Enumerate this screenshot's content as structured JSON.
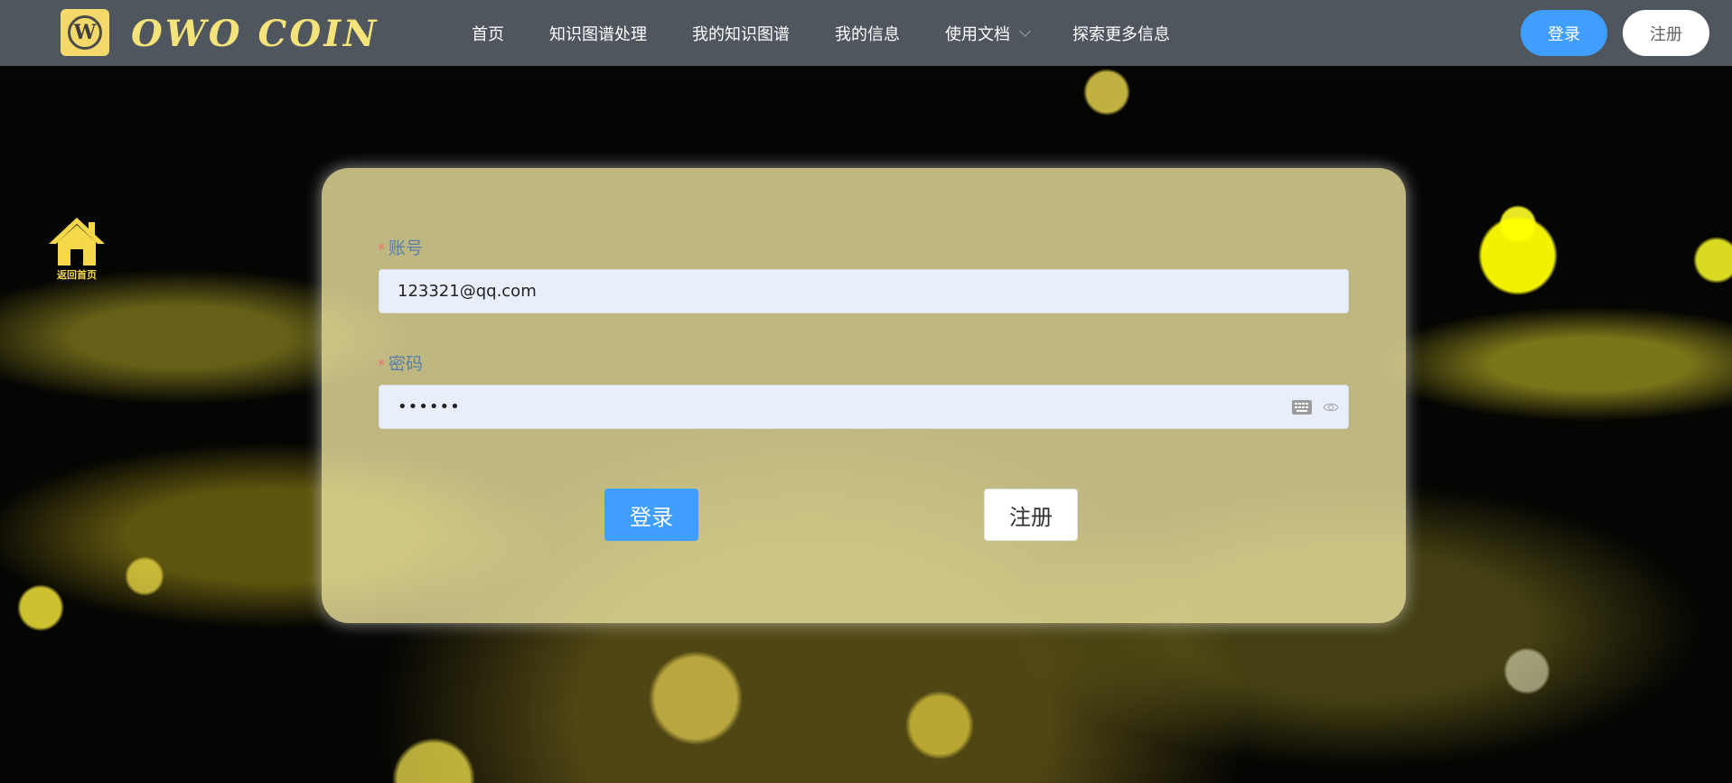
{
  "brand": {
    "logo_letter": "W",
    "name": "OWO COIN",
    "logo_color": "#f3d96a"
  },
  "nav": {
    "items": [
      {
        "label": "首页"
      },
      {
        "label": "知识图谱处理"
      },
      {
        "label": "我的知识图谱"
      },
      {
        "label": "我的信息"
      },
      {
        "label": "使用文档",
        "has_dropdown": true
      },
      {
        "label": "探索更多信息"
      }
    ],
    "login_label": "登录",
    "register_label": "注册"
  },
  "back_home": {
    "label": "返回首页",
    "icon": "home-icon"
  },
  "form": {
    "account": {
      "label": "账号",
      "required": true,
      "value": "123321@qq.com"
    },
    "password": {
      "label": "密码",
      "required": true,
      "masked_value": "••••••",
      "icons": [
        "keyboard-icon",
        "eye-icon"
      ]
    },
    "login_button": "登录",
    "register_button": "注册"
  },
  "colors": {
    "nav_bg": "#4f565e",
    "primary": "#409eff",
    "card_bg": "#eee4a0",
    "required_mark": "#f56c6c",
    "label_text": "#5a7fa8"
  }
}
